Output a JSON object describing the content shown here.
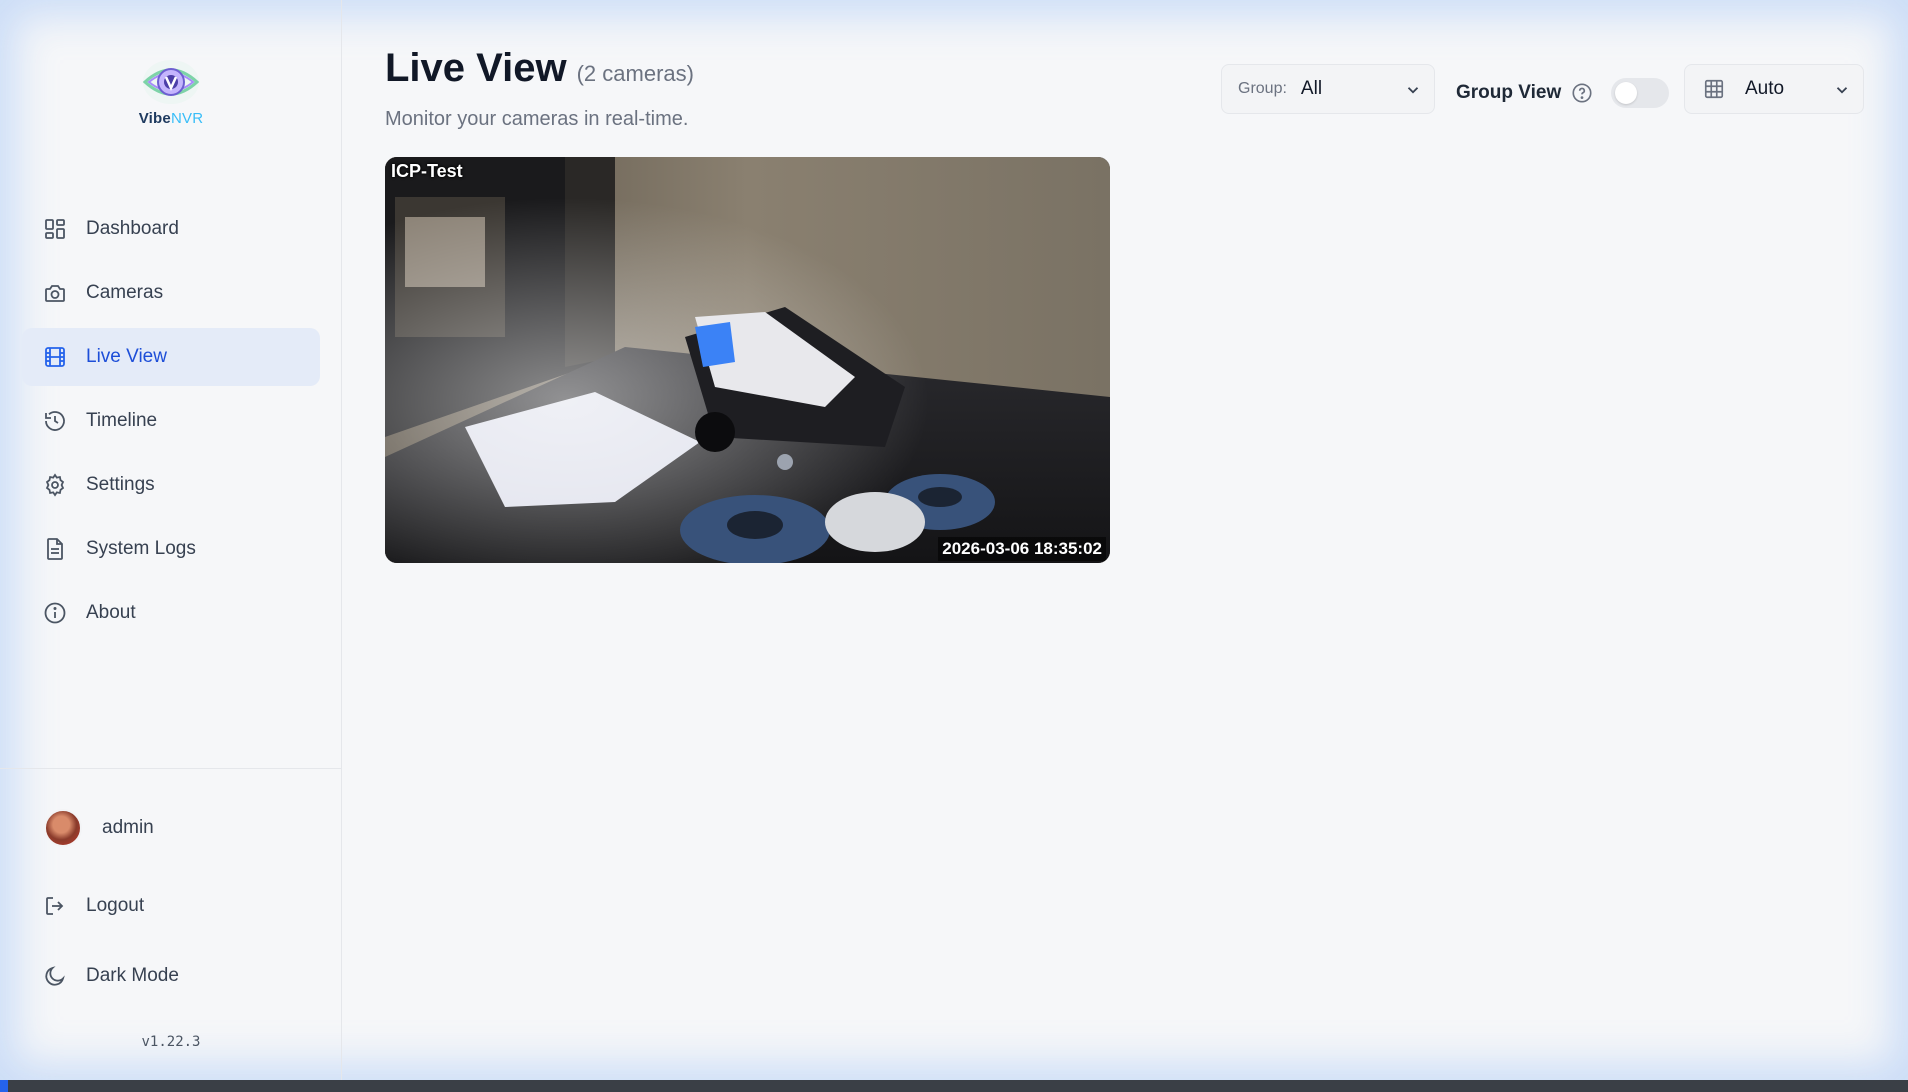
{
  "app": {
    "brand_primary": "Vibe",
    "brand_secondary": "NVR",
    "version": "v1.22.3",
    "accent_color": "#2563eb"
  },
  "sidebar": {
    "items": [
      {
        "label": "Dashboard",
        "icon": "dashboard-icon",
        "active": false
      },
      {
        "label": "Cameras",
        "icon": "camera-icon",
        "active": false
      },
      {
        "label": "Live View",
        "icon": "film-icon",
        "active": true
      },
      {
        "label": "Timeline",
        "icon": "history-icon",
        "active": false
      },
      {
        "label": "Settings",
        "icon": "gear-icon",
        "active": false
      },
      {
        "label": "System Logs",
        "icon": "document-icon",
        "active": false
      },
      {
        "label": "About",
        "icon": "info-icon",
        "active": false
      }
    ],
    "user": {
      "name": "admin"
    },
    "logout_label": "Logout",
    "dark_mode_label": "Dark Mode"
  },
  "main": {
    "title": "Live View",
    "camera_count": "(2 cameras)",
    "subtitle": "Monitor your cameras in real-time.",
    "group_filter": {
      "label": "Group:",
      "value": "All"
    },
    "group_view": {
      "label": "Group View",
      "enabled": false
    },
    "layout_select": {
      "value": "Auto",
      "icon": "grid-icon"
    }
  },
  "cameras": [
    {
      "name": "ICP-Test",
      "timestamp": "2026-03-06 18:35:02"
    }
  ]
}
